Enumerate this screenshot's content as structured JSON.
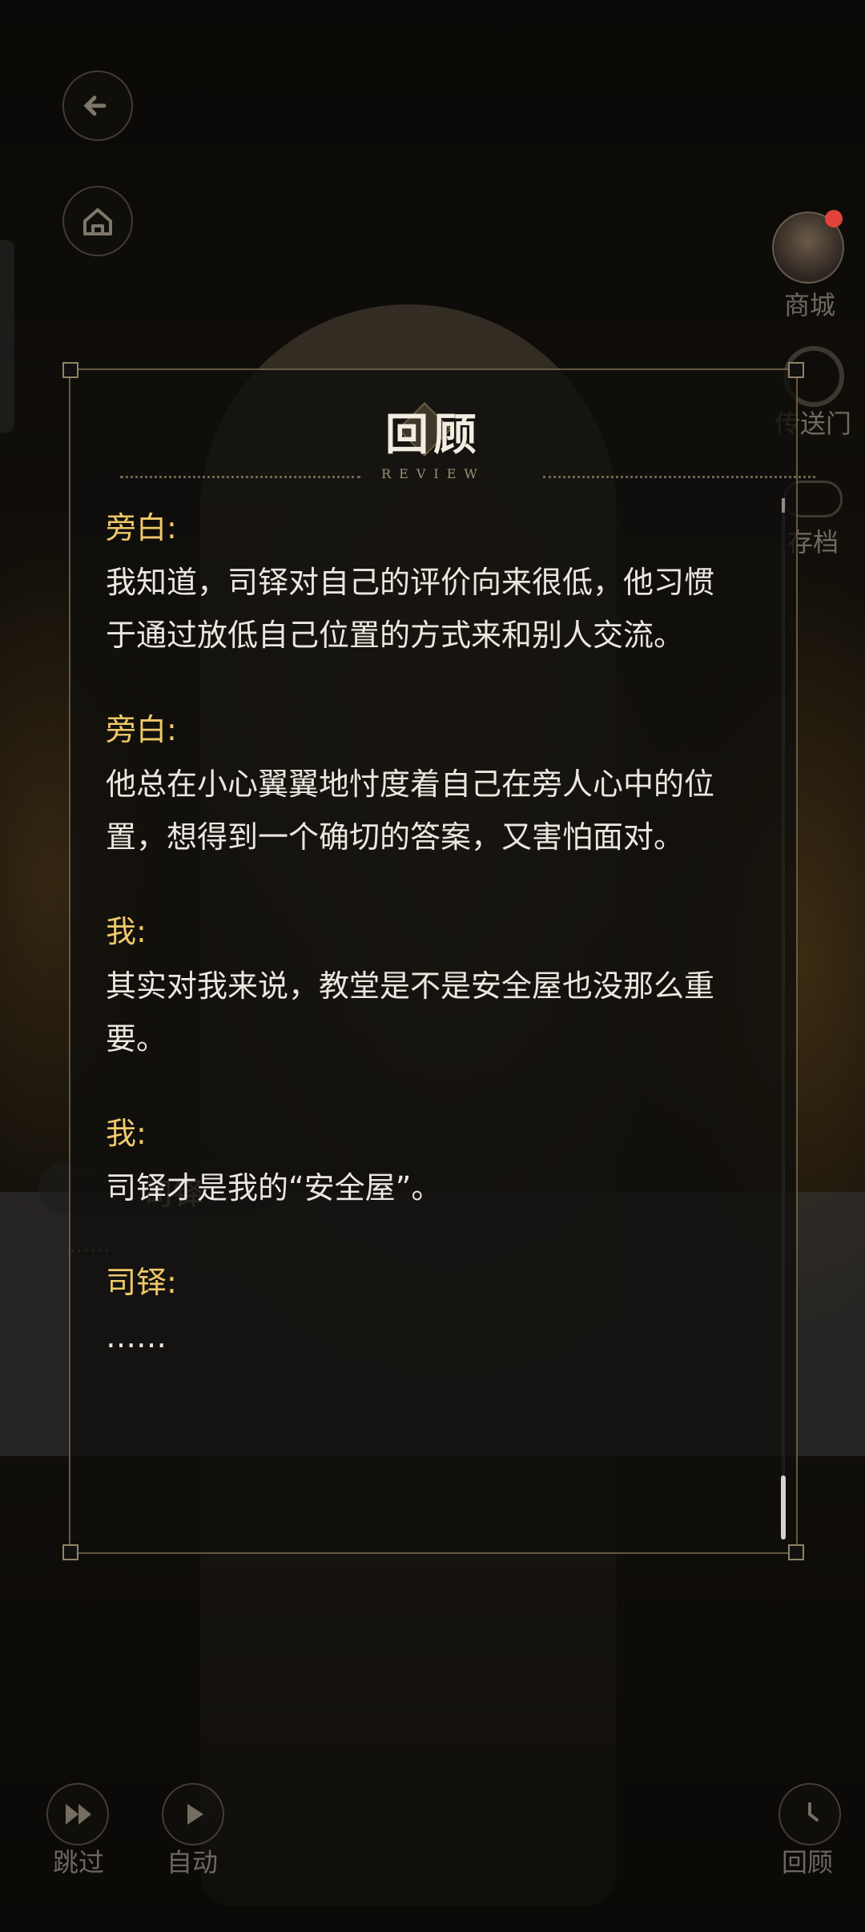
{
  "hud": {
    "back_icon": "back-arrow-icon",
    "home_icon": "home-icon",
    "shop_label": "商城",
    "portal_label": "传送门",
    "cloud_label": "存档",
    "skip_label": "跳过",
    "auto_label": "自动",
    "review_label": "回顾"
  },
  "scene": {
    "speaker": "司铎",
    "text": "……"
  },
  "review": {
    "title": "回顾",
    "subtitle": "REVIEW",
    "entries": [
      {
        "speaker": "旁白:",
        "lines": [
          "我知道，司铎对自己的评价向来很低，他习惯",
          "于通过放低自己位置的方式来和别人交流。"
        ]
      },
      {
        "speaker": "旁白:",
        "lines": [
          "他总在小心翼翼地忖度着自己在旁人心中的位",
          "置，想得到一个确切的答案，又害怕面对。"
        ]
      },
      {
        "speaker": "我:",
        "lines": [
          "其实对我来说，教堂是不是安全屋也没那么重",
          "要。"
        ]
      },
      {
        "speaker": "我:",
        "lines": [
          "司铎才是我的“安全屋”。"
        ]
      },
      {
        "speaker": "司铎:",
        "lines": [
          "……"
        ]
      }
    ]
  },
  "colors": {
    "speaker": "#efc86a",
    "text": "#ebe7df",
    "panel_border": "#aa966e",
    "notification": "#e0433c"
  }
}
